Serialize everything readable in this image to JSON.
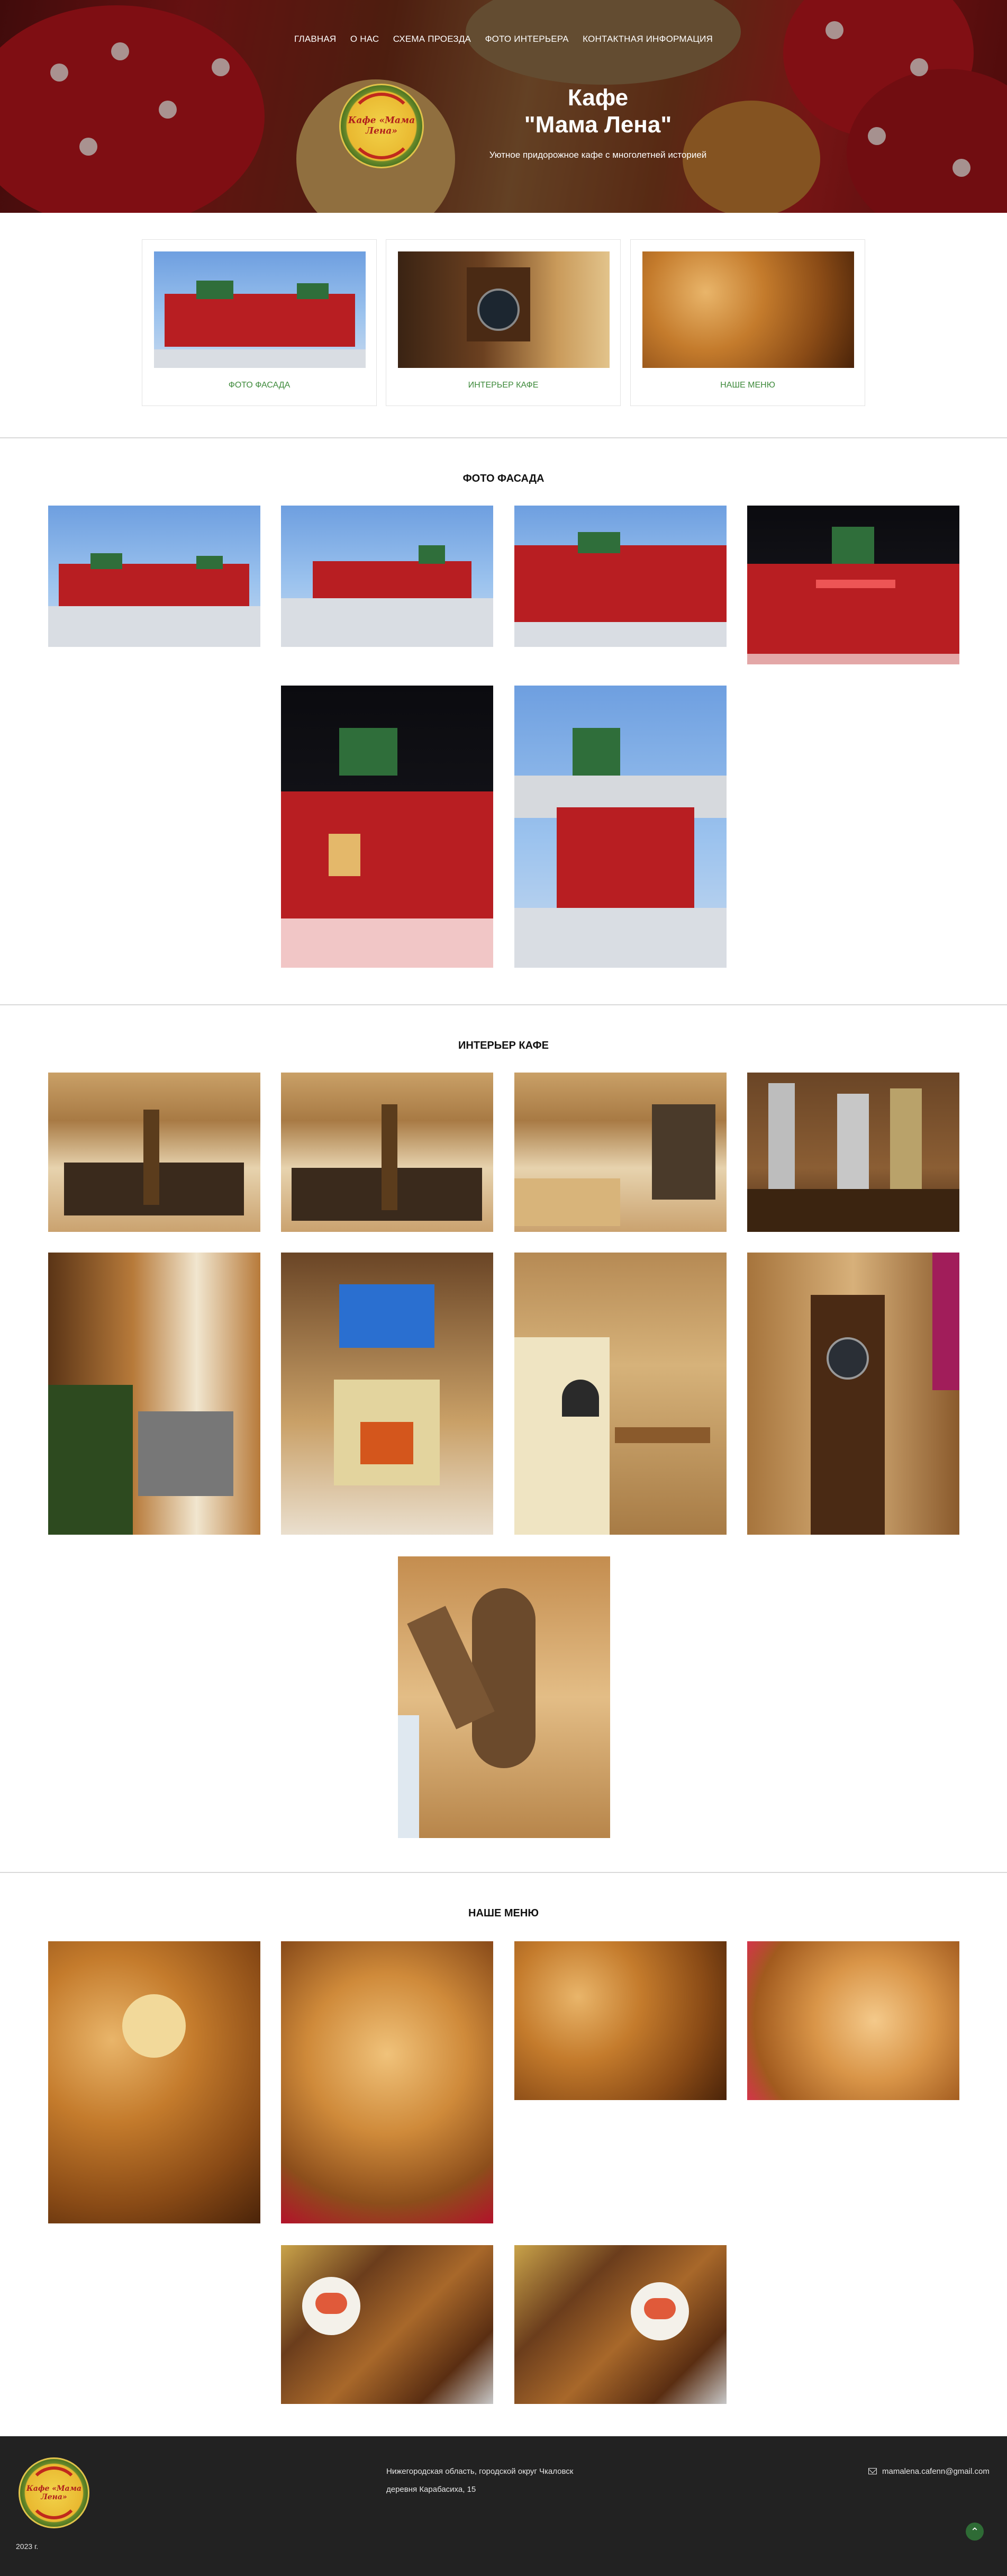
{
  "nav": {
    "items": [
      {
        "label": "ГЛАВНАЯ"
      },
      {
        "label": "О НАС"
      },
      {
        "label": "СХЕМА ПРОЕЗДА"
      },
      {
        "label": "ФОТО ИНТЕРЬЕРА"
      },
      {
        "label": "КОНТАКТНАЯ ИНФОРМАЦИЯ"
      }
    ]
  },
  "hero": {
    "logo_text": "Кафе «Мама Лена»",
    "title_line1": "Кафе",
    "title_line2": "\"Мама Лена\"",
    "subtitle": "Уютное придорожное кафе с многолетней историей"
  },
  "cards": [
    {
      "label": "ФОТО ФАСАДА"
    },
    {
      "label": "ИНТЕРЬЕР КАФЕ"
    },
    {
      "label": "НАШЕ МЕНЮ"
    }
  ],
  "sections": {
    "facade_title": "ФОТО ФАСАДА",
    "interior_title": "ИНТЕРЬЕР КАФЕ",
    "menu_title": "НАШЕ МЕНЮ"
  },
  "footer": {
    "logo_text": "Кафе «Мама Лена»",
    "address_line1": "Нижегородская область, городской округ Чкаловск",
    "address_line2": "деревня Карабасиха, 15",
    "email": "mamalena.cafenn@gmail.com",
    "year": "2023 г.",
    "to_top_icon": "⌃"
  },
  "colors": {
    "accent_green": "#3e8a3b",
    "footer_bg": "#222222",
    "divider": "#d9d9d9"
  }
}
